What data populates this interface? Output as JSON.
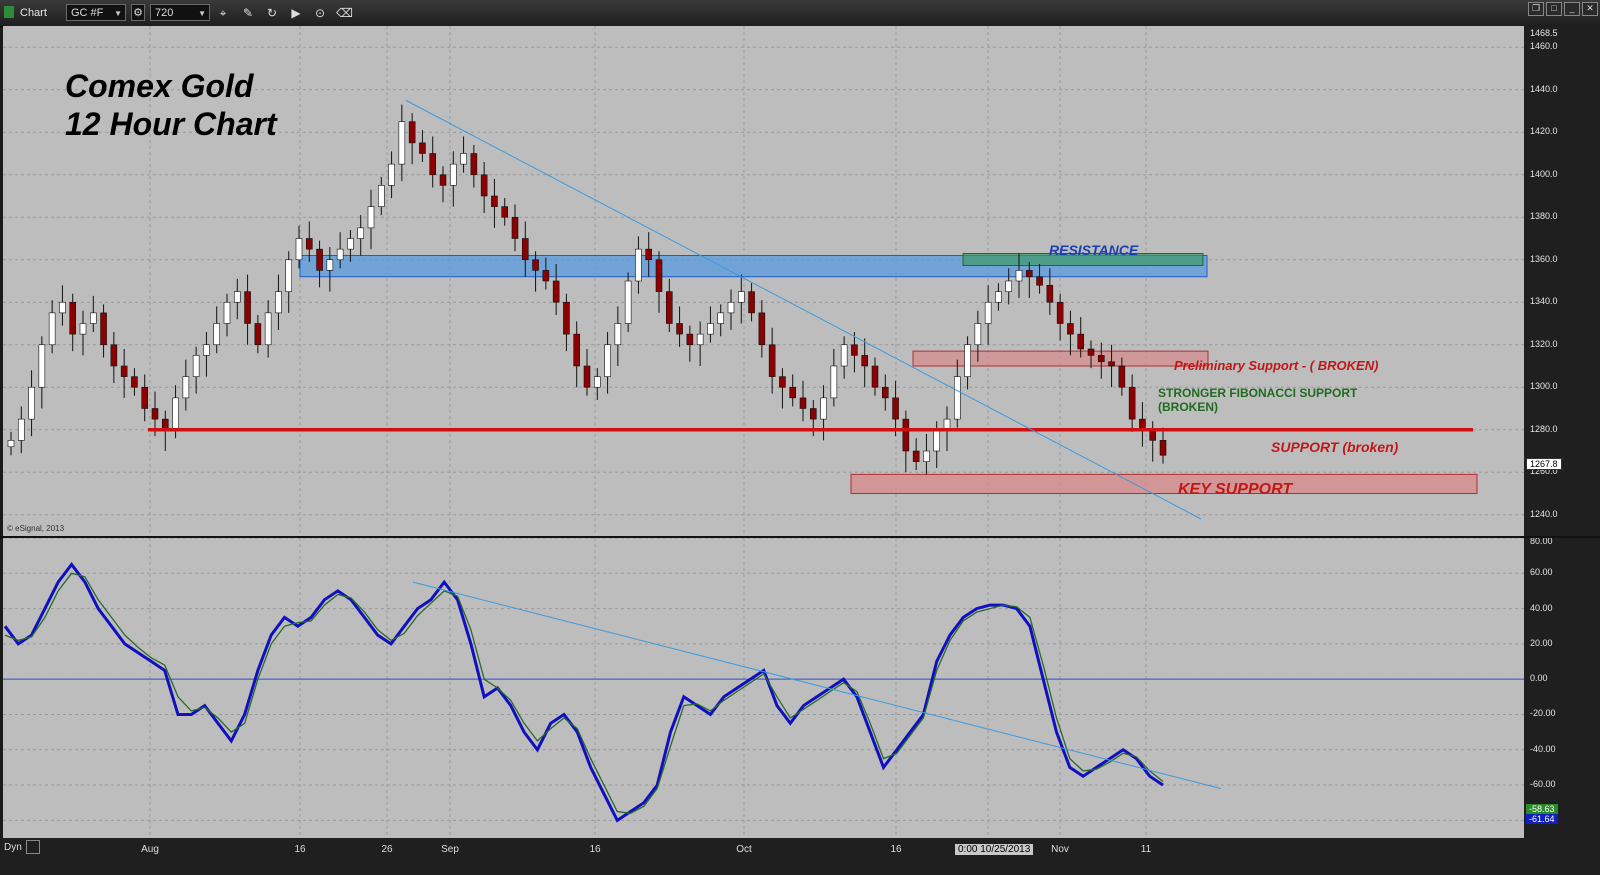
{
  "window": {
    "title": "Chart",
    "symbol": "GC #F",
    "interval": "720",
    "tools": [
      "gear-icon",
      "pencil-icon",
      "cursor-icon",
      "play-icon",
      "zoom-icon",
      "eraser-icon"
    ]
  },
  "chart_data": [
    {
      "type": "candlestick",
      "title": "Comex Gold\n12 Hour Chart",
      "title_lines": [
        "Comex Gold",
        "12 Hour Chart"
      ],
      "copyright": "© eSignal, 2013",
      "ylim": [
        1230,
        1470
      ],
      "y_ticks": [
        1240,
        1260,
        1280,
        1300,
        1320,
        1340,
        1360,
        1380,
        1400,
        1420,
        1440,
        1460
      ],
      "top_label": "1468.5",
      "last_price": "1267.8",
      "x_labels": [
        "Aug",
        "16",
        "26",
        "Sep",
        "16",
        "Oct",
        "16",
        "10/25/2013",
        "Nov",
        "11"
      ],
      "crosshair_label": "0:00 10/25/2013",
      "closes": [
        1275,
        1285,
        1300,
        1320,
        1335,
        1340,
        1325,
        1330,
        1335,
        1320,
        1310,
        1305,
        1300,
        1290,
        1285,
        1280,
        1295,
        1305,
        1315,
        1320,
        1330,
        1340,
        1345,
        1330,
        1320,
        1335,
        1345,
        1360,
        1370,
        1365,
        1355,
        1360,
        1365,
        1370,
        1375,
        1385,
        1395,
        1405,
        1425,
        1415,
        1410,
        1400,
        1395,
        1405,
        1410,
        1400,
        1390,
        1385,
        1380,
        1370,
        1360,
        1355,
        1350,
        1340,
        1325,
        1310,
        1300,
        1305,
        1320,
        1330,
        1350,
        1365,
        1360,
        1345,
        1330,
        1325,
        1320,
        1325,
        1330,
        1335,
        1340,
        1345,
        1335,
        1320,
        1305,
        1300,
        1295,
        1290,
        1285,
        1295,
        1310,
        1320,
        1315,
        1310,
        1300,
        1295,
        1285,
        1270,
        1265,
        1270,
        1280,
        1285,
        1305,
        1320,
        1330,
        1340,
        1345,
        1350,
        1355,
        1352,
        1348,
        1340,
        1330,
        1325,
        1318,
        1315,
        1312,
        1310,
        1300,
        1285,
        1280,
        1275,
        1268
      ],
      "levels": [
        {
          "label": "RESISTANCE",
          "price_low": 1352,
          "price_high": 1362,
          "color": "#3b8fd6"
        },
        {
          "label": "Preliminary Support - ( BROKEN)",
          "price_low": 1310,
          "price_high": 1317,
          "color": "#c96a6a"
        },
        {
          "label": "STRONGER FIBONACCI SUPPORT (BROKEN)",
          "price": 1280,
          "color": "#1f6b1f"
        },
        {
          "label": "SUPPORT  (broken)",
          "price": 1280,
          "color": "#d01010"
        },
        {
          "label": "KEY SUPPORT",
          "price_low": 1250,
          "price_high": 1259,
          "color": "#c96a6a"
        }
      ],
      "trendline": {
        "from": {
          "label": "Sep",
          "price": 1435
        },
        "to": {
          "label": "11",
          "price": 1238
        }
      }
    },
    {
      "type": "line",
      "title": "",
      "ylim": [
        -90,
        80
      ],
      "y_ticks": [
        80,
        60,
        40,
        20,
        0,
        -20,
        -40,
        -60,
        -80
      ],
      "last_values": [
        "-58.63",
        "-61.64"
      ],
      "series": [
        {
          "color": "#1010c0",
          "values": [
            30,
            20,
            25,
            40,
            55,
            65,
            55,
            40,
            30,
            20,
            15,
            10,
            5,
            -20,
            -20,
            -15,
            -25,
            -35,
            -20,
            5,
            25,
            35,
            30,
            35,
            45,
            50,
            45,
            35,
            25,
            20,
            30,
            40,
            45,
            55,
            45,
            20,
            -10,
            -5,
            -15,
            -30,
            -40,
            -25,
            -20,
            -30,
            -50,
            -65,
            -80,
            -75,
            -70,
            -60,
            -30,
            -10,
            -15,
            -20,
            -10,
            -5,
            0,
            5,
            -15,
            -25,
            -15,
            -10,
            -5,
            0,
            -10,
            -30,
            -50,
            -40,
            -30,
            -20,
            10,
            25,
            35,
            40,
            42,
            42,
            40,
            30,
            0,
            -30,
            -50,
            -55,
            -50,
            -45,
            -40,
            -45,
            -55,
            -60
          ]
        },
        {
          "color": "#2a6a2a",
          "values": [
            25,
            22,
            24,
            35,
            50,
            60,
            58,
            45,
            35,
            25,
            18,
            12,
            8,
            -10,
            -18,
            -16,
            -22,
            -30,
            -25,
            0,
            20,
            30,
            32,
            33,
            42,
            48,
            46,
            38,
            28,
            22,
            26,
            36,
            43,
            50,
            47,
            28,
            0,
            -5,
            -12,
            -25,
            -35,
            -28,
            -22,
            -28,
            -45,
            -60,
            -75,
            -76,
            -72,
            -62,
            -38,
            -15,
            -14,
            -18,
            -12,
            -7,
            -2,
            3,
            -10,
            -22,
            -17,
            -12,
            -7,
            -2,
            -7,
            -25,
            -45,
            -42,
            -32,
            -22,
            5,
            22,
            33,
            38,
            40,
            42,
            41,
            35,
            8,
            -22,
            -45,
            -52,
            -51,
            -47,
            -42,
            -44,
            -52,
            -58
          ]
        }
      ],
      "trendline": {
        "from_value": 55,
        "to_value": -62
      },
      "zero_line": 0
    }
  ],
  "xaxis": {
    "left_label": "Dyn"
  }
}
